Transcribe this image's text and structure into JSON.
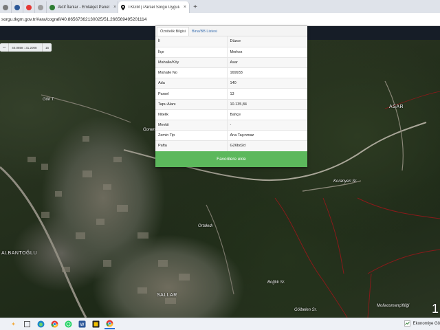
{
  "browser": {
    "tabs": [
      {
        "title": "",
        "color": "#7a7a7a"
      },
      {
        "title": "",
        "color": "#2b5797"
      },
      {
        "title": "",
        "color": "#e53935"
      },
      {
        "title": "",
        "color": "#9e9e9e"
      },
      {
        "title": "Aktif İlanlar - Emlakjet Panel",
        "color": "#2e7d32"
      },
      {
        "title": "TKGM | Parsel Sorgu Uygulamas",
        "color": "#111111"
      }
    ],
    "new_tab": "+",
    "close_glyph": "×",
    "address": "sorgu.tkgm.gov.tr/#ara/cografi/40.86567362130025/51.266569495201114"
  },
  "map": {
    "toolbar": {
      "coords": "40.0858 : 31.2008",
      "zoom": "15"
    },
    "labels": {
      "gok_t": "Gök T.",
      "gonen": "Gonen",
      "asar": "ASAR",
      "albantoglu": "ALBANTOĞLU",
      "ortakidi": "Ortakıdı",
      "bogluk_sr": "Boğlık Sr.",
      "gokbelen_sr": "Gölbelen Sr.",
      "sallar": "SALLAR",
      "mollaosmanciftligi": "Mollaosmançiftliği",
      "koranyeri_sr": "Koranyeri Sr."
    },
    "big_digit": "1"
  },
  "panel": {
    "tabs": [
      "Öznitelik Bilgisi",
      "Bina/BB Listesi"
    ],
    "rows": [
      {
        "key": "İl",
        "value": "Düzce"
      },
      {
        "key": "İlçe",
        "value": "Merkez"
      },
      {
        "key": "Mahalle/Köy",
        "value": "Asar"
      },
      {
        "key": "Mahalle No",
        "value": "169933"
      },
      {
        "key": "Ada",
        "value": "140"
      },
      {
        "key": "Parsel",
        "value": "13"
      },
      {
        "key": "Tapu Alanı",
        "value": "10.135,84"
      },
      {
        "key": "Nitelik",
        "value": "Bahçe"
      },
      {
        "key": "Mevkii",
        "value": "-"
      },
      {
        "key": "Zemin Tip",
        "value": "Ana Taşınmaz"
      },
      {
        "key": "Pafta",
        "value": "G26bd2d"
      }
    ],
    "favorite_button": "Favorilere ekle"
  },
  "taskbar": {
    "status_text": "Ekonomiye Gö"
  },
  "colors": {
    "accent_green": "#5cb85c",
    "parcel_border": "#8a1a1a"
  }
}
